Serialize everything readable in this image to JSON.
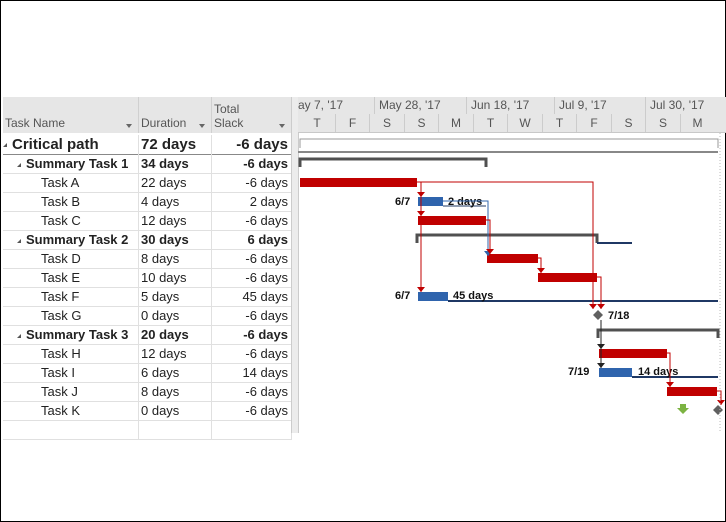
{
  "columns": {
    "task_name": "Task Name",
    "duration": "Duration",
    "total_slack_line1": "Total",
    "total_slack_line2": "Slack"
  },
  "rows": [
    {
      "name": "Critical path",
      "duration": "72 days",
      "slack": "-6 days",
      "level": 0,
      "type": "project"
    },
    {
      "name": "Summary Task 1",
      "duration": "34 days",
      "slack": "-6 days",
      "level": 1,
      "type": "summary"
    },
    {
      "name": "Task A",
      "duration": "22 days",
      "slack": "-6 days",
      "level": 2,
      "type": "task"
    },
    {
      "name": "Task B",
      "duration": "4 days",
      "slack": "2 days",
      "level": 2,
      "type": "task"
    },
    {
      "name": "Task C",
      "duration": "12 days",
      "slack": "-6 days",
      "level": 2,
      "type": "task"
    },
    {
      "name": "Summary Task 2",
      "duration": "30 days",
      "slack": "6 days",
      "level": 1,
      "type": "summary"
    },
    {
      "name": "Task D",
      "duration": "8 days",
      "slack": "-6 days",
      "level": 2,
      "type": "task"
    },
    {
      "name": "Task E",
      "duration": "10 days",
      "slack": "-6 days",
      "level": 2,
      "type": "task"
    },
    {
      "name": "Task F",
      "duration": "5 days",
      "slack": "45 days",
      "level": 2,
      "type": "task"
    },
    {
      "name": "Task G",
      "duration": "0 days",
      "slack": "-6 days",
      "level": 2,
      "type": "milestone"
    },
    {
      "name": "Summary Task 3",
      "duration": "20 days",
      "slack": "-6 days",
      "level": 1,
      "type": "summary"
    },
    {
      "name": "Task H",
      "duration": "12 days",
      "slack": "-6 days",
      "level": 2,
      "type": "task"
    },
    {
      "name": "Task I",
      "duration": "6 days",
      "slack": "14 days",
      "level": 2,
      "type": "task"
    },
    {
      "name": "Task J",
      "duration": "8 days",
      "slack": "-6 days",
      "level": 2,
      "type": "task"
    },
    {
      "name": "Task K",
      "duration": "0 days",
      "slack": "-6 days",
      "level": 2,
      "type": "milestone"
    }
  ],
  "timescale": {
    "weeks": [
      "ay 7, '17",
      "May 28, '17",
      "Jun 18, '17",
      "Jul 9, '17",
      "Jul 30, '17"
    ],
    "days": [
      "T",
      "F",
      "S",
      "S",
      "M",
      "T",
      "W",
      "T",
      "F",
      "S",
      "S",
      "M"
    ]
  },
  "bar_labels": {
    "task_b_start": "6/7",
    "task_b_slack": "2 days",
    "task_f_start": "6/7",
    "task_f_slack": "45 days",
    "task_g_date": "7/18",
    "task_i_start": "7/19",
    "task_i_slack": "14 days"
  },
  "colors": {
    "critical": "#c00000",
    "noncritical": "#2f64ad",
    "slack_line": "#1f3864",
    "summary": "#505050",
    "milestone": "#606060",
    "deadline": "#7cb342",
    "link_critical": "#c00000",
    "link_noncritical": "#2f64ad"
  }
}
